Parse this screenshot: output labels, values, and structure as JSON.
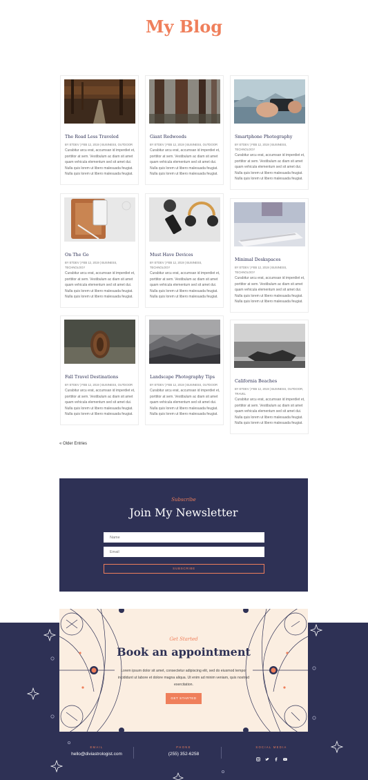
{
  "page": {
    "title": "My Blog"
  },
  "posts": [
    {
      "title": "The Road Less Traveled",
      "meta": "By Etdev | Feb 12, 2019 | Business, Outdoor",
      "excerpt": "Curabitur arcu erat, accumsan id imperdiet et, porttitor at sem. Vestibulum ac diam sit amet quam vehicula elementum sed sit amet dui. Nulla quis lorem ut libero malesuada feugiat. Nulla quis lorem ut libero malesuada feugiat.",
      "image": "forest-road-photo"
    },
    {
      "title": "Giant Redwoods",
      "meta": "By Etdev | Feb 12, 2019 | Business, Outdoor",
      "excerpt": "Curabitur arcu erat, accumsan id imperdiet et, porttitor at sem. Vestibulum ac diam sit amet quam vehicula elementum sed sit amet dui. Nulla quis lorem ut libero malesuada feugiat. Nulla quis lorem ut libero malesuada feugiat.",
      "image": "redwood-trees-photo"
    },
    {
      "title": "Smartphone Photography",
      "meta": "By Etdev | Feb 12, 2019 | Business, Technology",
      "excerpt": "Curabitur arcu erat, accumsan id imperdiet et, porttitor at sem. Vestibulum ac diam sit amet quam vehicula elementum sed sit amet dui. Nulla quis lorem ut libero malesuada feugiat. Nulla quis lorem ut libero malesuada feugiat.",
      "image": "hand-smartphone-photo"
    },
    {
      "title": "On The Go",
      "meta": "By Etdev | Feb 12, 2019 | Business, Technology",
      "excerpt": "Curabitur arcu erat, accumsan id imperdiet et, porttitor at sem. Vestibulum ac diam sit amet quam vehicula elementum sed sit amet dui. Nulla quis lorem ut libero malesuada feugiat. Nulla quis lorem ut libero malesuada feugiat.",
      "image": "tablet-phone-desk-photo"
    },
    {
      "title": "Must Have Devices",
      "meta": "By Etdev | Feb 12, 2019 | Business, Technology",
      "excerpt": "Curabitur arcu erat, accumsan id imperdiet et, porttitor at sem. Vestibulum ac diam sit amet quam vehicula elementum sed sit amet dui. Nulla quis lorem ut libero malesuada feugiat. Nulla quis lorem ut libero malesuada feugiat.",
      "image": "headphones-phone-photo"
    },
    {
      "title": "Minimal Deskspaces",
      "meta": "By Etdev | Feb 12, 2019 | Business, Technology",
      "excerpt": "Curabitur arcu erat, accumsan id imperdiet et, porttitor at sem. Vestibulum ac diam sit amet quam vehicula elementum sed sit amet dui. Nulla quis lorem ut libero malesuada feugiat. Nulla quis lorem ut libero malesuada feugiat.",
      "image": "keyboard-desk-photo"
    },
    {
      "title": "Fall Travel Destinations",
      "meta": "By Etdev | Feb 12, 2019 | Business, Outdoor",
      "excerpt": "Curabitur arcu erat, accumsan id imperdiet et, porttitor at sem. Vestibulum ac diam sit amet quam vehicula elementum sed sit amet dui. Nulla quis lorem ut libero malesuada feugiat. Nulla quis lorem ut libero malesuada feugiat.",
      "image": "pine-cone-photo"
    },
    {
      "title": "Landscape Photography Tips",
      "meta": "By Etdev | Feb 12, 2019 | Business, Outdoor",
      "excerpt": "Curabitur arcu erat, accumsan id imperdiet et, porttitor at sem. Vestibulum ac diam sit amet quam vehicula elementum sed sit amet dui. Nulla quis lorem ut libero malesuada feugiat. Nulla quis lorem ut libero malesuada feugiat.",
      "image": "misty-mountains-photo"
    },
    {
      "title": "California Beaches",
      "meta": "By Etdev | Feb 12, 2019 | Business, Outdoor, Travel",
      "excerpt": "Curabitur arcu erat, accumsan id imperdiet et, porttitor at sem. Vestibulum ac diam sit amet quam vehicula elementum sed sit amet dui. Nulla quis lorem ut libero malesuada feugiat. Nulla quis lorem ut libero malesuada feugiat.",
      "image": "rocky-beach-photo"
    }
  ],
  "pagination": {
    "older_label": "« Older Entries"
  },
  "newsletter": {
    "kicker": "Subscribe",
    "title": "Join My Newsletter",
    "name_placeholder": "Name",
    "email_placeholder": "Email",
    "button_label": "SUBSCRIBE"
  },
  "appointment": {
    "kicker": "Get Started",
    "title": "Book an appointment",
    "body": "Lorem ipsum dolor sit amet, consectetur adipiscing elit, sed do eiusmod tempor incididunt ut labore et dolore magna aliqua. Ut enim ad minim veniam, quis nostrud exercitation.",
    "button_label": "GET STARTED"
  },
  "footer": {
    "email_label": "Email",
    "email_value": "hello@diviastrologist.com",
    "phone_label": "Phone",
    "phone_value": "(255) 352-6258",
    "social_label": "Social Media",
    "social_icons": [
      "instagram-icon",
      "twitter-icon",
      "facebook-icon",
      "youtube-icon"
    ]
  },
  "colors": {
    "accent": "#ef7f5b",
    "navy": "#2e3155",
    "cream": "#fbeee1"
  }
}
